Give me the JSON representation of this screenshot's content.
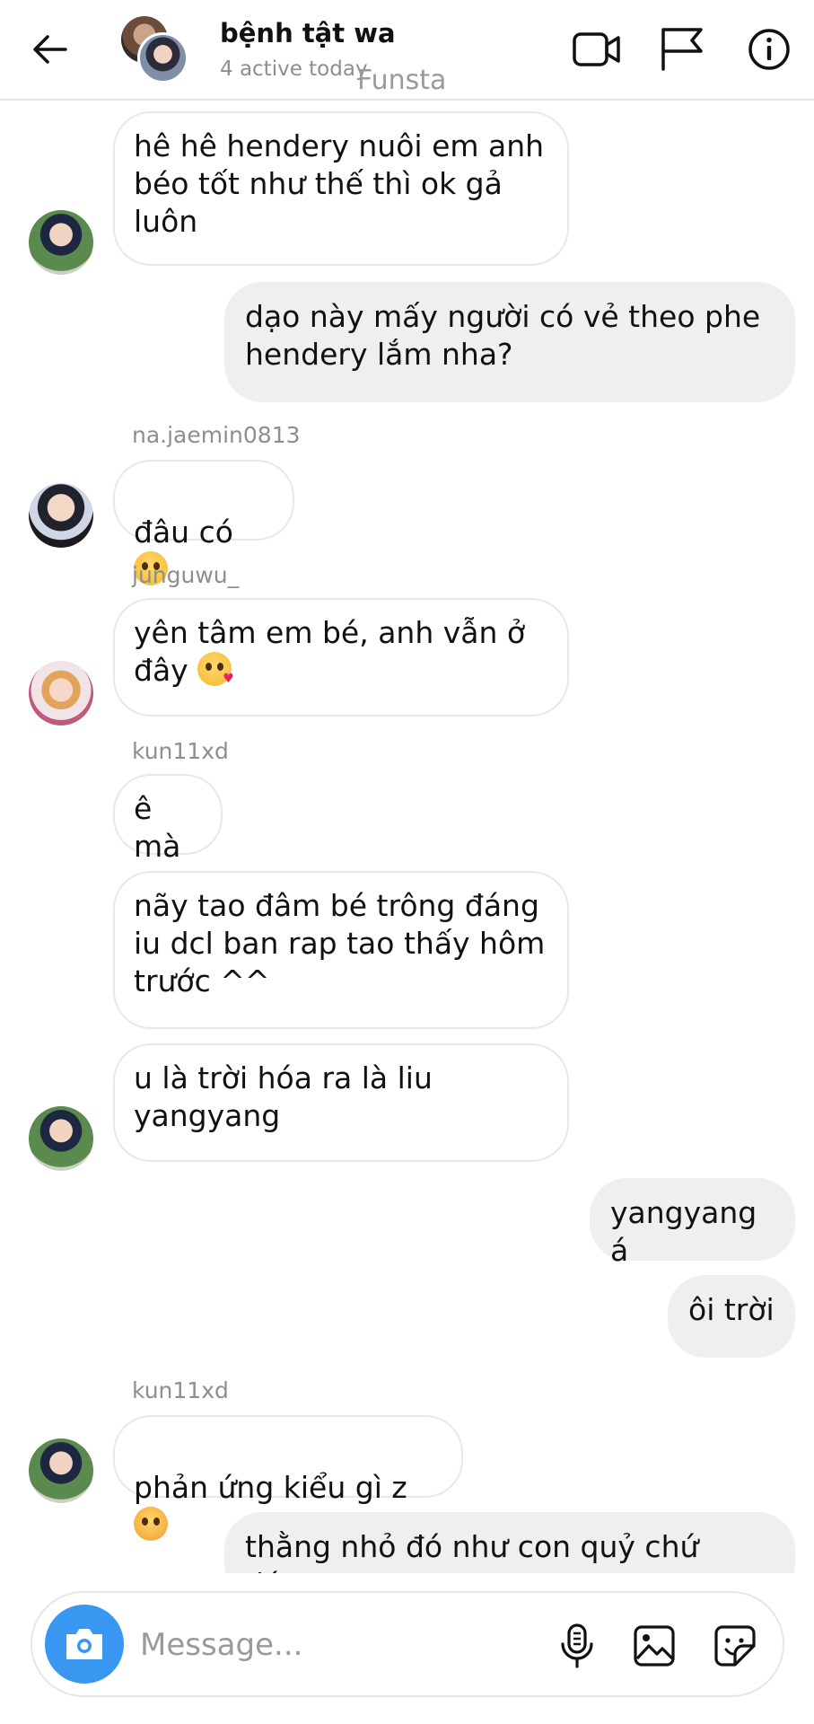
{
  "header": {
    "title": "bệnh tật wa",
    "status": "4 active today",
    "watermark": "Funsta",
    "icons": [
      "back-arrow-icon",
      "video-call-icon",
      "flag-icon",
      "info-icon"
    ]
  },
  "messages": [
    {
      "direction": "in",
      "sender": "",
      "text": "hê hê hendery nuôi em anh\nbéo tốt như thế thì ok gả\nluôn"
    },
    {
      "direction": "out",
      "text": "dạo này mấy người có vẻ theo phe\nhendery lắm nha?"
    },
    {
      "direction": "in",
      "sender": "na.jaemin0813",
      "text": "đâu có",
      "emoji": "pleading-face"
    },
    {
      "direction": "in",
      "sender": "junguwu_",
      "text_line1": "yên tâm em bé, anh vẫn ở",
      "text_line2": "đây",
      "emoji": "kissing-face"
    },
    {
      "direction": "in",
      "sender": "kun11xd",
      "text": "ê mà"
    },
    {
      "direction": "in",
      "text": "nãy tao đâm bé trông đáng\niu dcl ban rap tao thấy hôm\ntrước ^^"
    },
    {
      "direction": "in",
      "text": "u là trời hóa ra là liu\nyangyang"
    },
    {
      "direction": "out",
      "text": "yangyang á"
    },
    {
      "direction": "out",
      "text": "ôi trời"
    },
    {
      "direction": "in",
      "sender": "kun11xd",
      "text": "phản ứng kiểu gì z",
      "emoji": "angry-face"
    },
    {
      "direction": "out",
      "text": "thằng nhỏ đó như con quỷ chứ đáng"
    }
  ],
  "composer": {
    "placeholder": "Message...",
    "icons": [
      "camera-icon",
      "microphone-icon",
      "gallery-icon",
      "sticker-icon"
    ],
    "accent_color": "#3897f0"
  },
  "colors": {
    "incoming_bubble": "#ffffff",
    "outgoing_bubble": "#efefef",
    "muted_text": "#8e8e8e"
  }
}
